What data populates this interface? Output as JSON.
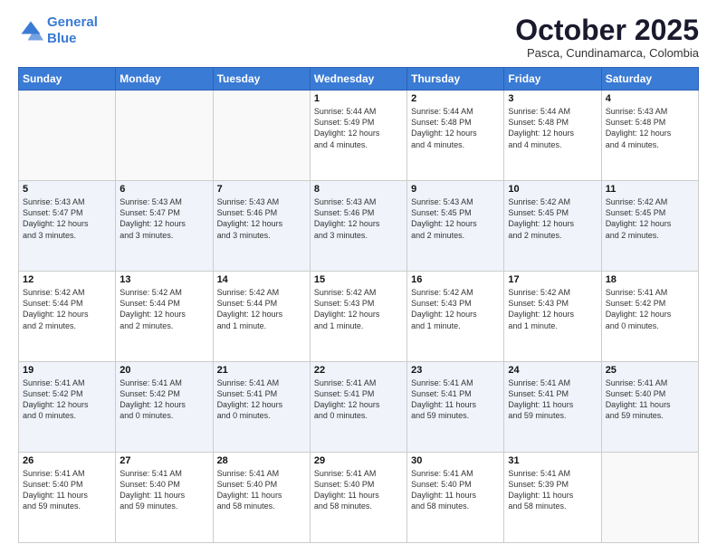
{
  "header": {
    "logo_line1": "General",
    "logo_line2": "Blue",
    "month": "October 2025",
    "location": "Pasca, Cundinamarca, Colombia"
  },
  "weekdays": [
    "Sunday",
    "Monday",
    "Tuesday",
    "Wednesday",
    "Thursday",
    "Friday",
    "Saturday"
  ],
  "weeks": [
    [
      {
        "day": "",
        "text": ""
      },
      {
        "day": "",
        "text": ""
      },
      {
        "day": "",
        "text": ""
      },
      {
        "day": "1",
        "text": "Sunrise: 5:44 AM\nSunset: 5:49 PM\nDaylight: 12 hours\nand 4 minutes."
      },
      {
        "day": "2",
        "text": "Sunrise: 5:44 AM\nSunset: 5:48 PM\nDaylight: 12 hours\nand 4 minutes."
      },
      {
        "day": "3",
        "text": "Sunrise: 5:44 AM\nSunset: 5:48 PM\nDaylight: 12 hours\nand 4 minutes."
      },
      {
        "day": "4",
        "text": "Sunrise: 5:43 AM\nSunset: 5:48 PM\nDaylight: 12 hours\nand 4 minutes."
      }
    ],
    [
      {
        "day": "5",
        "text": "Sunrise: 5:43 AM\nSunset: 5:47 PM\nDaylight: 12 hours\nand 3 minutes."
      },
      {
        "day": "6",
        "text": "Sunrise: 5:43 AM\nSunset: 5:47 PM\nDaylight: 12 hours\nand 3 minutes."
      },
      {
        "day": "7",
        "text": "Sunrise: 5:43 AM\nSunset: 5:46 PM\nDaylight: 12 hours\nand 3 minutes."
      },
      {
        "day": "8",
        "text": "Sunrise: 5:43 AM\nSunset: 5:46 PM\nDaylight: 12 hours\nand 3 minutes."
      },
      {
        "day": "9",
        "text": "Sunrise: 5:43 AM\nSunset: 5:45 PM\nDaylight: 12 hours\nand 2 minutes."
      },
      {
        "day": "10",
        "text": "Sunrise: 5:42 AM\nSunset: 5:45 PM\nDaylight: 12 hours\nand 2 minutes."
      },
      {
        "day": "11",
        "text": "Sunrise: 5:42 AM\nSunset: 5:45 PM\nDaylight: 12 hours\nand 2 minutes."
      }
    ],
    [
      {
        "day": "12",
        "text": "Sunrise: 5:42 AM\nSunset: 5:44 PM\nDaylight: 12 hours\nand 2 minutes."
      },
      {
        "day": "13",
        "text": "Sunrise: 5:42 AM\nSunset: 5:44 PM\nDaylight: 12 hours\nand 2 minutes."
      },
      {
        "day": "14",
        "text": "Sunrise: 5:42 AM\nSunset: 5:44 PM\nDaylight: 12 hours\nand 1 minute."
      },
      {
        "day": "15",
        "text": "Sunrise: 5:42 AM\nSunset: 5:43 PM\nDaylight: 12 hours\nand 1 minute."
      },
      {
        "day": "16",
        "text": "Sunrise: 5:42 AM\nSunset: 5:43 PM\nDaylight: 12 hours\nand 1 minute."
      },
      {
        "day": "17",
        "text": "Sunrise: 5:42 AM\nSunset: 5:43 PM\nDaylight: 12 hours\nand 1 minute."
      },
      {
        "day": "18",
        "text": "Sunrise: 5:41 AM\nSunset: 5:42 PM\nDaylight: 12 hours\nand 0 minutes."
      }
    ],
    [
      {
        "day": "19",
        "text": "Sunrise: 5:41 AM\nSunset: 5:42 PM\nDaylight: 12 hours\nand 0 minutes."
      },
      {
        "day": "20",
        "text": "Sunrise: 5:41 AM\nSunset: 5:42 PM\nDaylight: 12 hours\nand 0 minutes."
      },
      {
        "day": "21",
        "text": "Sunrise: 5:41 AM\nSunset: 5:41 PM\nDaylight: 12 hours\nand 0 minutes."
      },
      {
        "day": "22",
        "text": "Sunrise: 5:41 AM\nSunset: 5:41 PM\nDaylight: 12 hours\nand 0 minutes."
      },
      {
        "day": "23",
        "text": "Sunrise: 5:41 AM\nSunset: 5:41 PM\nDaylight: 11 hours\nand 59 minutes."
      },
      {
        "day": "24",
        "text": "Sunrise: 5:41 AM\nSunset: 5:41 PM\nDaylight: 11 hours\nand 59 minutes."
      },
      {
        "day": "25",
        "text": "Sunrise: 5:41 AM\nSunset: 5:40 PM\nDaylight: 11 hours\nand 59 minutes."
      }
    ],
    [
      {
        "day": "26",
        "text": "Sunrise: 5:41 AM\nSunset: 5:40 PM\nDaylight: 11 hours\nand 59 minutes."
      },
      {
        "day": "27",
        "text": "Sunrise: 5:41 AM\nSunset: 5:40 PM\nDaylight: 11 hours\nand 59 minutes."
      },
      {
        "day": "28",
        "text": "Sunrise: 5:41 AM\nSunset: 5:40 PM\nDaylight: 11 hours\nand 58 minutes."
      },
      {
        "day": "29",
        "text": "Sunrise: 5:41 AM\nSunset: 5:40 PM\nDaylight: 11 hours\nand 58 minutes."
      },
      {
        "day": "30",
        "text": "Sunrise: 5:41 AM\nSunset: 5:40 PM\nDaylight: 11 hours\nand 58 minutes."
      },
      {
        "day": "31",
        "text": "Sunrise: 5:41 AM\nSunset: 5:39 PM\nDaylight: 11 hours\nand 58 minutes."
      },
      {
        "day": "",
        "text": ""
      }
    ]
  ]
}
